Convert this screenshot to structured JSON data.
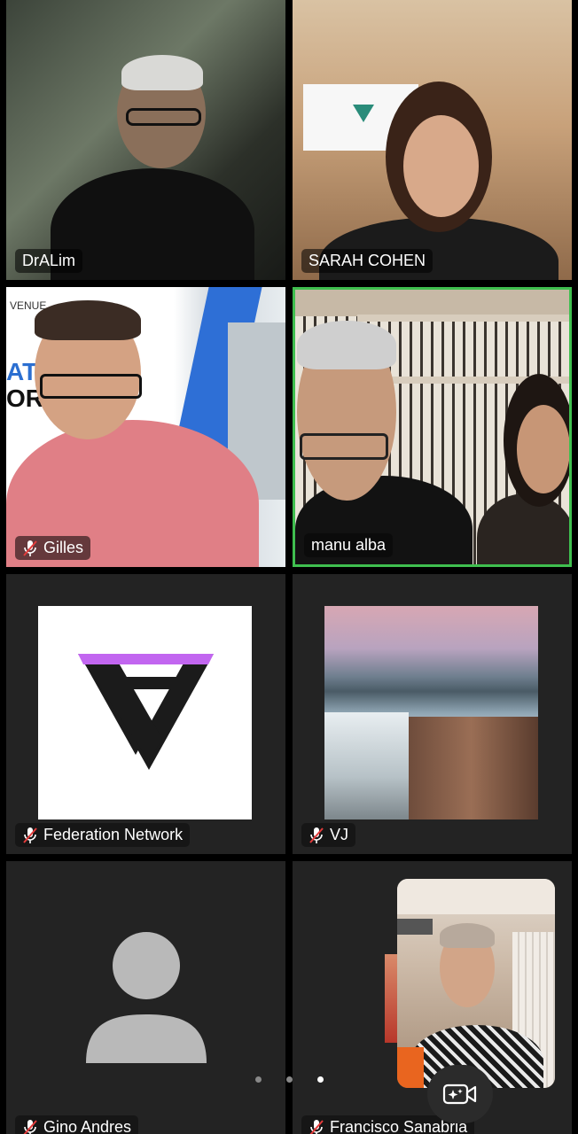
{
  "participants": [
    {
      "name": "DrALim",
      "muted": false,
      "active": false
    },
    {
      "name": "SARAH COHEN",
      "muted": false,
      "active": false
    },
    {
      "name": "Gilles",
      "muted": true,
      "active": false
    },
    {
      "name": "manu alba",
      "muted": false,
      "active": true
    },
    {
      "name": "Federation Network",
      "muted": true,
      "active": false
    },
    {
      "name": "VJ",
      "muted": true,
      "active": false
    },
    {
      "name": "Gino Andres",
      "muted": true,
      "active": false
    },
    {
      "name": "Francisco Sanabria",
      "muted": true,
      "active": false
    }
  ],
  "backdrop_text": {
    "gilles_banner_1": "VENUE",
    "gilles_banner_2": "ATI",
    "gilles_banner_3": "ORK"
  },
  "pagination": {
    "pages": 3,
    "current": 3
  },
  "colors": {
    "active_border": "#3fbf4f",
    "tile_bg": "#232323",
    "logo_purple": "#c266f0",
    "logo_dark": "#1b1b1b"
  },
  "icons": {
    "muted": "mic-off-icon",
    "camera_effects": "camera-sparkle-icon",
    "avatar_placeholder": "person-icon"
  }
}
